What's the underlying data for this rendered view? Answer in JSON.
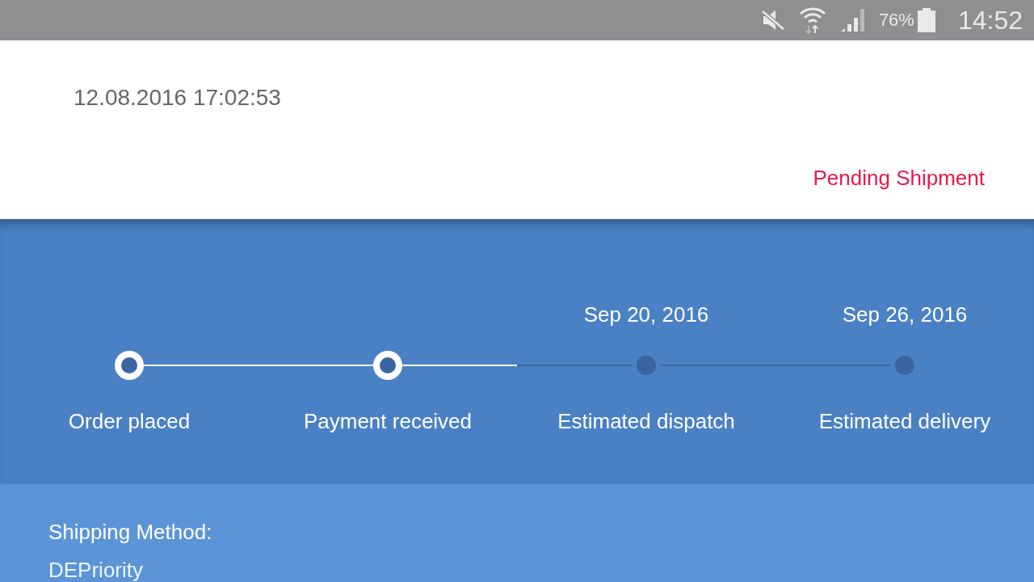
{
  "status_bar": {
    "battery": "76%",
    "time": "14:52"
  },
  "order": {
    "timestamp": "12.08.2016 17:02:53",
    "status": "Pending Shipment"
  },
  "steps": [
    {
      "label": "Order placed",
      "completed": true
    },
    {
      "label": "Payment received",
      "completed": true
    },
    {
      "label": "Estimated dispatch",
      "date": "Sep 20, 2016",
      "completed": false
    },
    {
      "label": "Estimated delivery",
      "date": "Sep 26, 2016",
      "completed": false
    }
  ],
  "shipping": {
    "heading": "Shipping Method:",
    "value": "DEPriority"
  }
}
